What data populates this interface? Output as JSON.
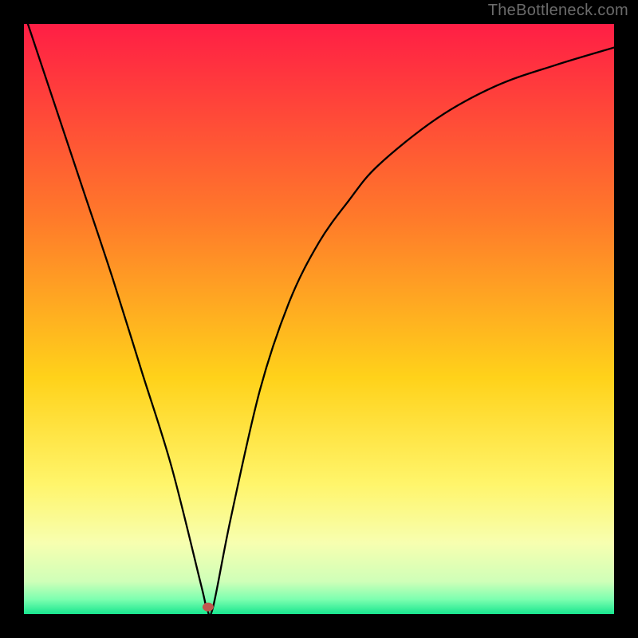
{
  "watermark": "TheBottleneck.com",
  "chart_data": {
    "type": "line",
    "title": "",
    "xlabel": "",
    "ylabel": "",
    "xlim": [
      0,
      100
    ],
    "ylim": [
      0,
      100
    ],
    "grid": false,
    "legend": false,
    "series": [
      {
        "name": "curve",
        "x": [
          0,
          5,
          10,
          15,
          20,
          25,
          30,
          31,
          32,
          35,
          40,
          45,
          50,
          55,
          60,
          70,
          80,
          90,
          100
        ],
        "values": [
          102,
          87,
          72,
          57,
          41,
          25,
          5,
          1,
          1,
          16,
          38,
          53,
          63,
          70,
          76,
          84,
          89.5,
          93,
          96
        ]
      }
    ],
    "marker": {
      "x": 31.2,
      "y": 1.2,
      "color": "#c0584f"
    },
    "background_gradient": {
      "stops": [
        {
          "offset": 0.0,
          "color": "#ff1e45"
        },
        {
          "offset": 0.33,
          "color": "#ff7a2a"
        },
        {
          "offset": 0.6,
          "color": "#ffd21a"
        },
        {
          "offset": 0.78,
          "color": "#fff56b"
        },
        {
          "offset": 0.88,
          "color": "#f7ffb0"
        },
        {
          "offset": 0.945,
          "color": "#cfffb8"
        },
        {
          "offset": 0.975,
          "color": "#7dffb0"
        },
        {
          "offset": 1.0,
          "color": "#18e68f"
        }
      ]
    }
  }
}
